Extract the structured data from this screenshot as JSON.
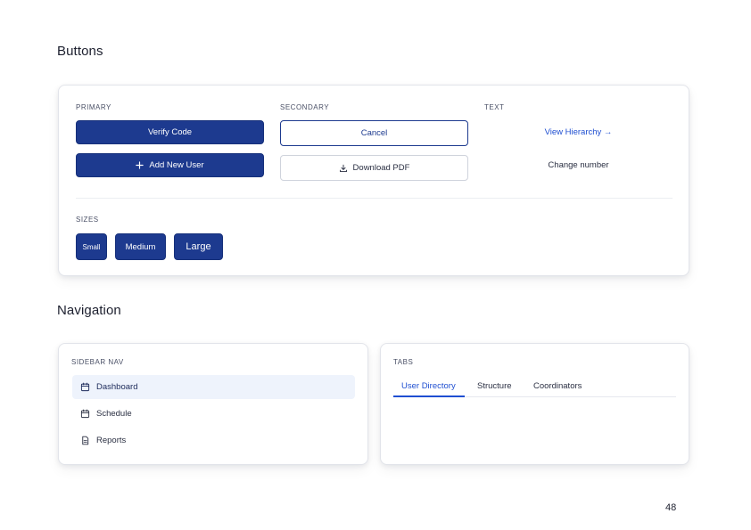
{
  "sections": {
    "buttons_title": "Buttons",
    "navigation_title": "Navigation"
  },
  "buttons": {
    "primary_heading": "PRIMARY",
    "secondary_heading": "SECONDARY",
    "text_heading": "TEXT",
    "sizes_heading": "SIZES",
    "primary": {
      "verify_code": "Verify Code",
      "add_new_user": "Add New User",
      "add_icon": "plus-icon"
    },
    "secondary": {
      "cancel": "Cancel",
      "download_pdf": "Download PDF",
      "download_icon": "download-icon"
    },
    "text": {
      "view_hierarchy": "View Hierarchy →",
      "change_number": "Change number"
    },
    "sizes": {
      "small": "Small",
      "medium": "Medium",
      "large": "Large"
    }
  },
  "navigation": {
    "sidebar_heading": "SIDEBAR NAV",
    "sidebar_items": [
      {
        "label": "Dashboard",
        "icon": "calendar-icon",
        "active": true
      },
      {
        "label": "Schedule",
        "icon": "calendar-icon",
        "active": false
      },
      {
        "label": "Reports",
        "icon": "document-icon",
        "active": false
      }
    ],
    "tabs_heading": "TABS",
    "tabs": [
      {
        "label": "User Directory",
        "active": true
      },
      {
        "label": "Structure",
        "active": false
      },
      {
        "label": "Coordinators",
        "active": false
      }
    ]
  },
  "page_number": "48",
  "colors": {
    "primary": "#1d3a8f",
    "accent_link": "#1f4fd1",
    "active_nav_bg": "#eef3fc"
  }
}
